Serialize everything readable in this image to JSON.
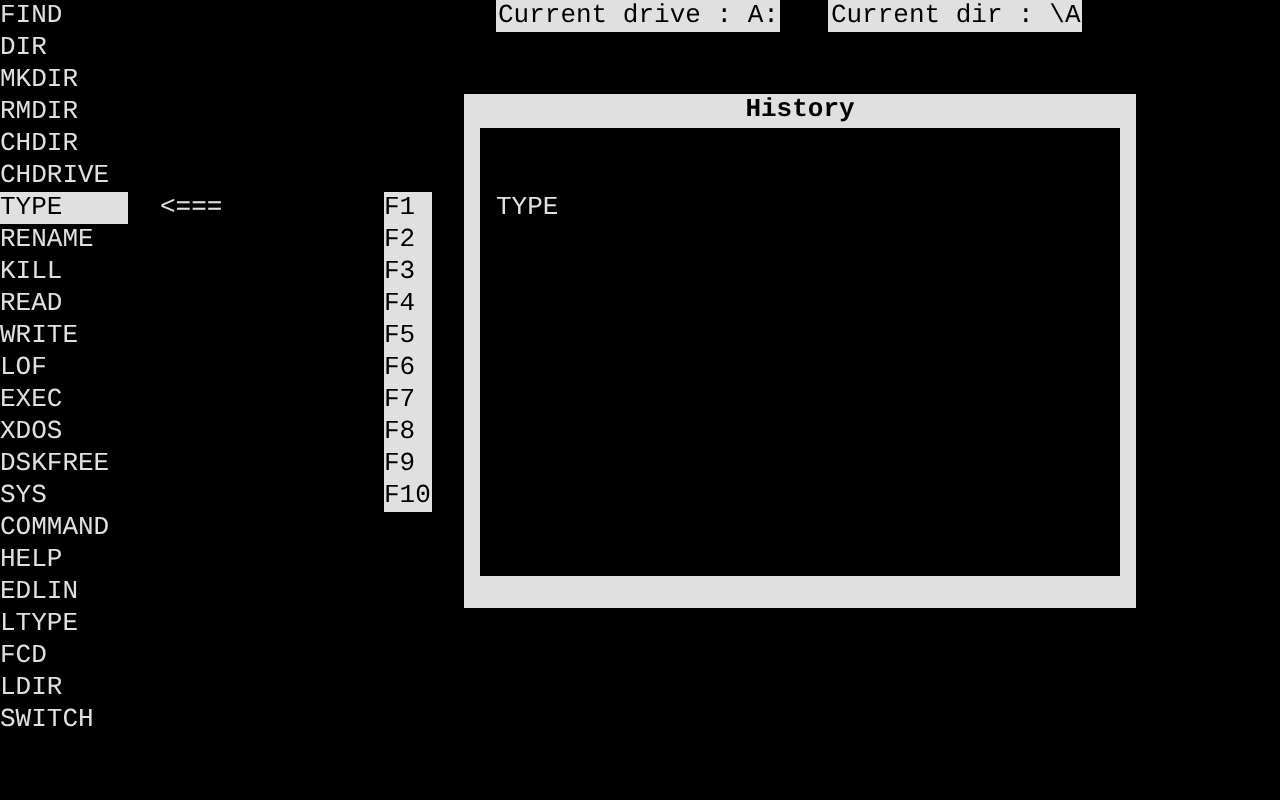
{
  "commands": [
    {
      "label": "FIND",
      "selected": false
    },
    {
      "label": "DIR",
      "selected": false
    },
    {
      "label": "MKDIR",
      "selected": false
    },
    {
      "label": "RMDIR",
      "selected": false
    },
    {
      "label": "CHDIR",
      "selected": false
    },
    {
      "label": "CHDRIVE",
      "selected": false
    },
    {
      "label": "TYPE",
      "selected": true
    },
    {
      "label": "RENAME",
      "selected": false
    },
    {
      "label": "KILL",
      "selected": false
    },
    {
      "label": "READ",
      "selected": false
    },
    {
      "label": "WRITE",
      "selected": false
    },
    {
      "label": "LOF",
      "selected": false
    },
    {
      "label": "EXEC",
      "selected": false
    },
    {
      "label": "XDOS",
      "selected": false
    },
    {
      "label": "DSKFREE",
      "selected": false
    },
    {
      "label": "SYS",
      "selected": false
    },
    {
      "label": "COMMAND",
      "selected": false
    },
    {
      "label": "HELP",
      "selected": false
    },
    {
      "label": "EDLIN",
      "selected": false
    },
    {
      "label": "LTYPE",
      "selected": false
    },
    {
      "label": "FCD",
      "selected": false
    },
    {
      "label": "LDIR",
      "selected": false
    },
    {
      "label": "SWITCH",
      "selected": false
    }
  ],
  "selection_arrow": "<===",
  "function_keys": [
    "F1",
    "F2",
    "F3",
    "F4",
    "F5",
    "F6",
    "F7",
    "F8",
    "F9",
    "F10"
  ],
  "status": {
    "current_drive": "Current drive : A:",
    "current_dir": "Current dir : \\A"
  },
  "history": {
    "title": "History",
    "entries": [
      "TYPE"
    ]
  }
}
